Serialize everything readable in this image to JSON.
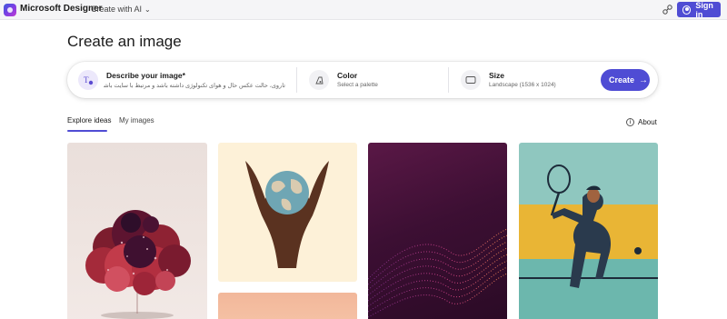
{
  "header": {
    "brand": "Microsoft Designer",
    "menu_label": "Create with AI",
    "signin_label": "Sign in"
  },
  "page": {
    "title": "Create an image"
  },
  "prompt_bar": {
    "describe": {
      "label": "Describe your image*",
      "value": "تاروی، حالت عکس حال و هوای تکنولوژی داشته باشد و مرتبط با سایت باشد"
    },
    "color": {
      "label": "Color",
      "value": "Select a palette"
    },
    "size": {
      "label": "Size",
      "value": "Landscape (1536 x 1024)"
    },
    "create_label": "Create"
  },
  "tabs": [
    {
      "label": "Explore ideas",
      "active": true
    },
    {
      "label": "My images",
      "active": false
    }
  ],
  "about_label": "About",
  "gallery": [
    {
      "subject": "crimson cloud of spheres"
    },
    {
      "subject": "hands holding earth"
    },
    {
      "subject": "peach gradient"
    },
    {
      "subject": "purple particle wave"
    },
    {
      "subject": "tennis player"
    }
  ],
  "colors": {
    "accent": "#4f4cd4",
    "topbar_bg": "#f5f5f7"
  }
}
